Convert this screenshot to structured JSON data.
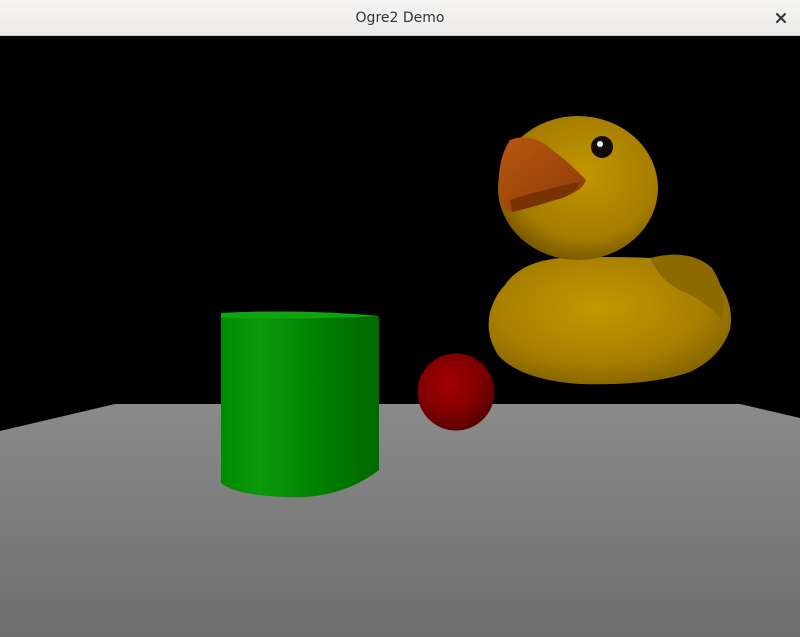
{
  "window": {
    "title": "Ogre2 Demo",
    "close_icon": "close-icon"
  },
  "scene": {
    "background": "#000000",
    "objects": [
      {
        "name": "ground-plane",
        "color": "#7a7a7a"
      },
      {
        "name": "green-cylinder",
        "color": "#0a8a0a"
      },
      {
        "name": "red-sphere",
        "color": "#8a0000"
      },
      {
        "name": "rubber-duck",
        "color": "#b08a00"
      }
    ]
  }
}
